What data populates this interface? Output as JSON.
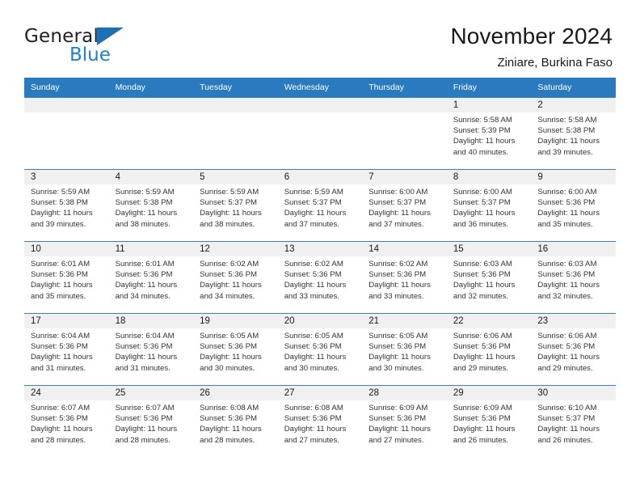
{
  "brand": {
    "name_part1": "General",
    "name_part2": "Blue",
    "logo_icon": "triangle-logo-icon"
  },
  "header": {
    "title": "November 2024",
    "subtitle": "Ziniare, Burkina Faso"
  },
  "colors": {
    "header_blue": "#2a7ac0",
    "row_rule_blue": "#3a7fbf",
    "daynum_band": "#f0f0f0",
    "brand_blue": "#2080d0",
    "text": "#1a1a1a"
  },
  "weekday_headers": [
    "Sunday",
    "Monday",
    "Tuesday",
    "Wednesday",
    "Thursday",
    "Friday",
    "Saturday"
  ],
  "weeks": [
    [
      {
        "day": "",
        "empty": true
      },
      {
        "day": "",
        "empty": true
      },
      {
        "day": "",
        "empty": true
      },
      {
        "day": "",
        "empty": true
      },
      {
        "day": "",
        "empty": true
      },
      {
        "day": "1",
        "sunrise": "Sunrise: 5:58 AM",
        "sunset": "Sunset: 5:39 PM",
        "daylight": "Daylight: 11 hours and 40 minutes."
      },
      {
        "day": "2",
        "sunrise": "Sunrise: 5:58 AM",
        "sunset": "Sunset: 5:38 PM",
        "daylight": "Daylight: 11 hours and 39 minutes."
      }
    ],
    [
      {
        "day": "3",
        "sunrise": "Sunrise: 5:59 AM",
        "sunset": "Sunset: 5:38 PM",
        "daylight": "Daylight: 11 hours and 39 minutes."
      },
      {
        "day": "4",
        "sunrise": "Sunrise: 5:59 AM",
        "sunset": "Sunset: 5:38 PM",
        "daylight": "Daylight: 11 hours and 38 minutes."
      },
      {
        "day": "5",
        "sunrise": "Sunrise: 5:59 AM",
        "sunset": "Sunset: 5:37 PM",
        "daylight": "Daylight: 11 hours and 38 minutes."
      },
      {
        "day": "6",
        "sunrise": "Sunrise: 5:59 AM",
        "sunset": "Sunset: 5:37 PM",
        "daylight": "Daylight: 11 hours and 37 minutes."
      },
      {
        "day": "7",
        "sunrise": "Sunrise: 6:00 AM",
        "sunset": "Sunset: 5:37 PM",
        "daylight": "Daylight: 11 hours and 37 minutes."
      },
      {
        "day": "8",
        "sunrise": "Sunrise: 6:00 AM",
        "sunset": "Sunset: 5:37 PM",
        "daylight": "Daylight: 11 hours and 36 minutes."
      },
      {
        "day": "9",
        "sunrise": "Sunrise: 6:00 AM",
        "sunset": "Sunset: 5:36 PM",
        "daylight": "Daylight: 11 hours and 35 minutes."
      }
    ],
    [
      {
        "day": "10",
        "sunrise": "Sunrise: 6:01 AM",
        "sunset": "Sunset: 5:36 PM",
        "daylight": "Daylight: 11 hours and 35 minutes."
      },
      {
        "day": "11",
        "sunrise": "Sunrise: 6:01 AM",
        "sunset": "Sunset: 5:36 PM",
        "daylight": "Daylight: 11 hours and 34 minutes."
      },
      {
        "day": "12",
        "sunrise": "Sunrise: 6:02 AM",
        "sunset": "Sunset: 5:36 PM",
        "daylight": "Daylight: 11 hours and 34 minutes."
      },
      {
        "day": "13",
        "sunrise": "Sunrise: 6:02 AM",
        "sunset": "Sunset: 5:36 PM",
        "daylight": "Daylight: 11 hours and 33 minutes."
      },
      {
        "day": "14",
        "sunrise": "Sunrise: 6:02 AM",
        "sunset": "Sunset: 5:36 PM",
        "daylight": "Daylight: 11 hours and 33 minutes."
      },
      {
        "day": "15",
        "sunrise": "Sunrise: 6:03 AM",
        "sunset": "Sunset: 5:36 PM",
        "daylight": "Daylight: 11 hours and 32 minutes."
      },
      {
        "day": "16",
        "sunrise": "Sunrise: 6:03 AM",
        "sunset": "Sunset: 5:36 PM",
        "daylight": "Daylight: 11 hours and 32 minutes."
      }
    ],
    [
      {
        "day": "17",
        "sunrise": "Sunrise: 6:04 AM",
        "sunset": "Sunset: 5:36 PM",
        "daylight": "Daylight: 11 hours and 31 minutes."
      },
      {
        "day": "18",
        "sunrise": "Sunrise: 6:04 AM",
        "sunset": "Sunset: 5:36 PM",
        "daylight": "Daylight: 11 hours and 31 minutes."
      },
      {
        "day": "19",
        "sunrise": "Sunrise: 6:05 AM",
        "sunset": "Sunset: 5:36 PM",
        "daylight": "Daylight: 11 hours and 30 minutes."
      },
      {
        "day": "20",
        "sunrise": "Sunrise: 6:05 AM",
        "sunset": "Sunset: 5:36 PM",
        "daylight": "Daylight: 11 hours and 30 minutes."
      },
      {
        "day": "21",
        "sunrise": "Sunrise: 6:05 AM",
        "sunset": "Sunset: 5:36 PM",
        "daylight": "Daylight: 11 hours and 30 minutes."
      },
      {
        "day": "22",
        "sunrise": "Sunrise: 6:06 AM",
        "sunset": "Sunset: 5:36 PM",
        "daylight": "Daylight: 11 hours and 29 minutes."
      },
      {
        "day": "23",
        "sunrise": "Sunrise: 6:06 AM",
        "sunset": "Sunset: 5:36 PM",
        "daylight": "Daylight: 11 hours and 29 minutes."
      }
    ],
    [
      {
        "day": "24",
        "sunrise": "Sunrise: 6:07 AM",
        "sunset": "Sunset: 5:36 PM",
        "daylight": "Daylight: 11 hours and 28 minutes."
      },
      {
        "day": "25",
        "sunrise": "Sunrise: 6:07 AM",
        "sunset": "Sunset: 5:36 PM",
        "daylight": "Daylight: 11 hours and 28 minutes."
      },
      {
        "day": "26",
        "sunrise": "Sunrise: 6:08 AM",
        "sunset": "Sunset: 5:36 PM",
        "daylight": "Daylight: 11 hours and 28 minutes."
      },
      {
        "day": "27",
        "sunrise": "Sunrise: 6:08 AM",
        "sunset": "Sunset: 5:36 PM",
        "daylight": "Daylight: 11 hours and 27 minutes."
      },
      {
        "day": "28",
        "sunrise": "Sunrise: 6:09 AM",
        "sunset": "Sunset: 5:36 PM",
        "daylight": "Daylight: 11 hours and 27 minutes."
      },
      {
        "day": "29",
        "sunrise": "Sunrise: 6:09 AM",
        "sunset": "Sunset: 5:36 PM",
        "daylight": "Daylight: 11 hours and 26 minutes."
      },
      {
        "day": "30",
        "sunrise": "Sunrise: 6:10 AM",
        "sunset": "Sunset: 5:37 PM",
        "daylight": "Daylight: 11 hours and 26 minutes."
      }
    ]
  ]
}
